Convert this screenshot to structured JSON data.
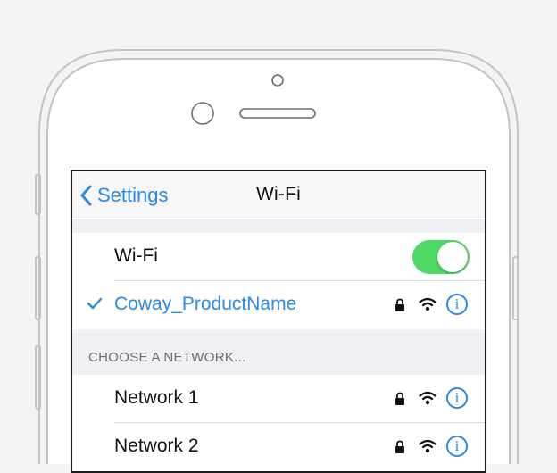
{
  "navbar": {
    "back_label": "Settings",
    "title": "Wi-Fi"
  },
  "wifi_toggle": {
    "label": "Wi-Fi",
    "enabled": true,
    "on_color": "#4cd964"
  },
  "connected_network": {
    "name": "Coway_ProductName",
    "selected": true,
    "secured": true,
    "info_icon": "i"
  },
  "networks_section": {
    "header": "CHOOSE A NETWORK...",
    "items": [
      {
        "name": "Network 1",
        "secured": true,
        "info_icon": "i"
      },
      {
        "name": "Network 2",
        "secured": true,
        "info_icon": "i"
      }
    ]
  },
  "colors": {
    "accent": "#2a8ae6",
    "background": "#f4f4f5",
    "grouped_background": "#efeff4"
  },
  "icons": [
    "chevron-left-icon",
    "checkmark-icon",
    "lock-icon",
    "wifi-icon",
    "info-icon"
  ]
}
